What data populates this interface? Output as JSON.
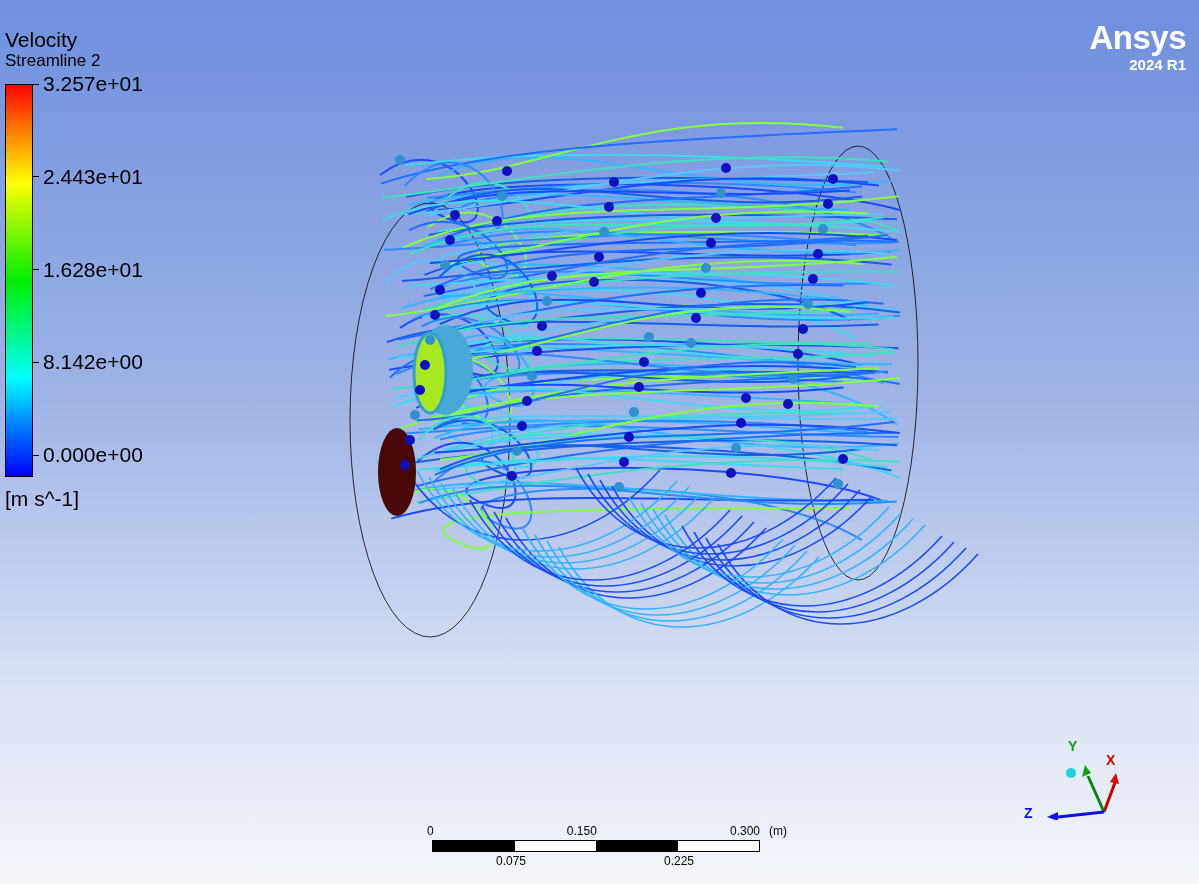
{
  "legend": {
    "title": "Velocity",
    "subtitle": "Streamline 2",
    "labels": [
      "3.257e+01",
      "2.443e+01",
      "1.628e+01",
      "8.142e+00",
      "0.000e+00"
    ],
    "units": "[m s^-1]"
  },
  "logo": {
    "brand": "Ansys",
    "version": "2024 R1"
  },
  "axis_triad": {
    "x": "X",
    "y": "Y",
    "z": "Z"
  },
  "scale_bar": {
    "top_labels": [
      "0",
      "0.150",
      "0.300"
    ],
    "unit": "(m)",
    "bottom_labels": [
      "0.075",
      "0.225"
    ]
  }
}
